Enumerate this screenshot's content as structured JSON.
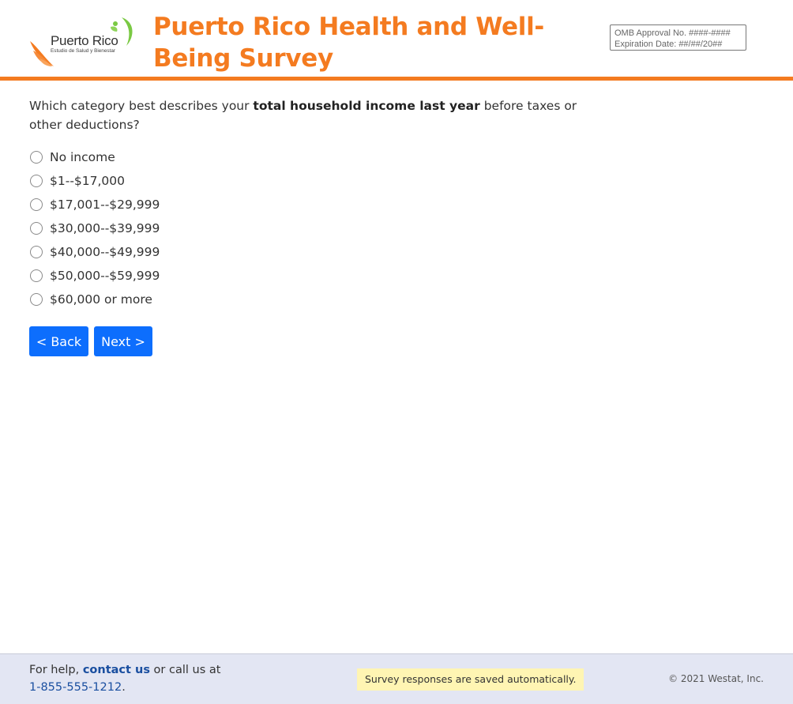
{
  "header": {
    "logo_name": "Puerto Rico",
    "logo_tagline": "Estudio de Salud y Bienestar",
    "title": "Puerto Rico Health and Well-Being Survey",
    "omb_approval": "OMB Approval No. ####-####",
    "expiration": "Expiration Date: ##/##/20##"
  },
  "question": {
    "prefix": "Which category best describes your ",
    "emphasis": "total household income last year",
    "suffix": " before taxes or other deductions?"
  },
  "options": [
    {
      "label": "No income",
      "selected": false
    },
    {
      "label": "$1--$17,000",
      "selected": false
    },
    {
      "label": "$17,001--$29,999",
      "selected": false
    },
    {
      "label": "$30,000--$39,999",
      "selected": false
    },
    {
      "label": "$40,000--$49,999",
      "selected": false
    },
    {
      "label": "$50,000--$59,999",
      "selected": false
    },
    {
      "label": "$60,000 or more",
      "selected": false
    }
  ],
  "buttons": {
    "back": "< Back",
    "next": "Next >"
  },
  "footer": {
    "help_prefix": "For help, ",
    "contact_link": "contact us",
    "help_middle": " or call us at",
    "phone": "1-855-555-1212",
    "phone_suffix": ".",
    "saved_notice": "Survey responses are saved automatically.",
    "copyright": "© 2021 Westat, Inc."
  },
  "colors": {
    "brand_orange": "#f47b20",
    "button_blue": "#0d6efd",
    "footer_bg": "#e3e6f3",
    "notice_bg": "#fff5b3",
    "logo_green": "#7ac943"
  }
}
